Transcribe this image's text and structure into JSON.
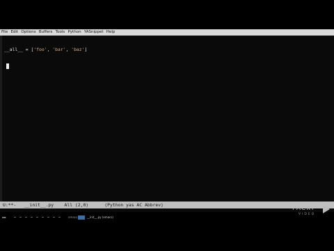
{
  "menu": [
    "File",
    "Edit",
    "Options",
    "Buffers",
    "Tools",
    "Python",
    "YASnippet",
    "Help"
  ],
  "code": {
    "prefix": "__all__ = [",
    "s1": "'foo'",
    "sep1": ", ",
    "s2": "'bar'",
    "sep2": ", ",
    "s3": "'baz'",
    "suffix": "]"
  },
  "modeline": {
    "status": "U:**-",
    "buffer": "__init__.py",
    "position": "All (2,0)",
    "modes": "(Python yas AC Abbrev)"
  },
  "taskbar": {
    "start_label": "▪▪",
    "small_label": "emacs",
    "active_window_title": "__init__.py (emacs)",
    "emacs_icon": "emacs-icon"
  },
  "logo": {
    "text": "PACKT",
    "subtitle": "VIDEO"
  },
  "colors": {
    "string": "#d9b68c",
    "modeline_bg": "#bfbfbf",
    "menubar_bg": "#d9d9d9",
    "taskbar_active": "#3a6ea5"
  }
}
